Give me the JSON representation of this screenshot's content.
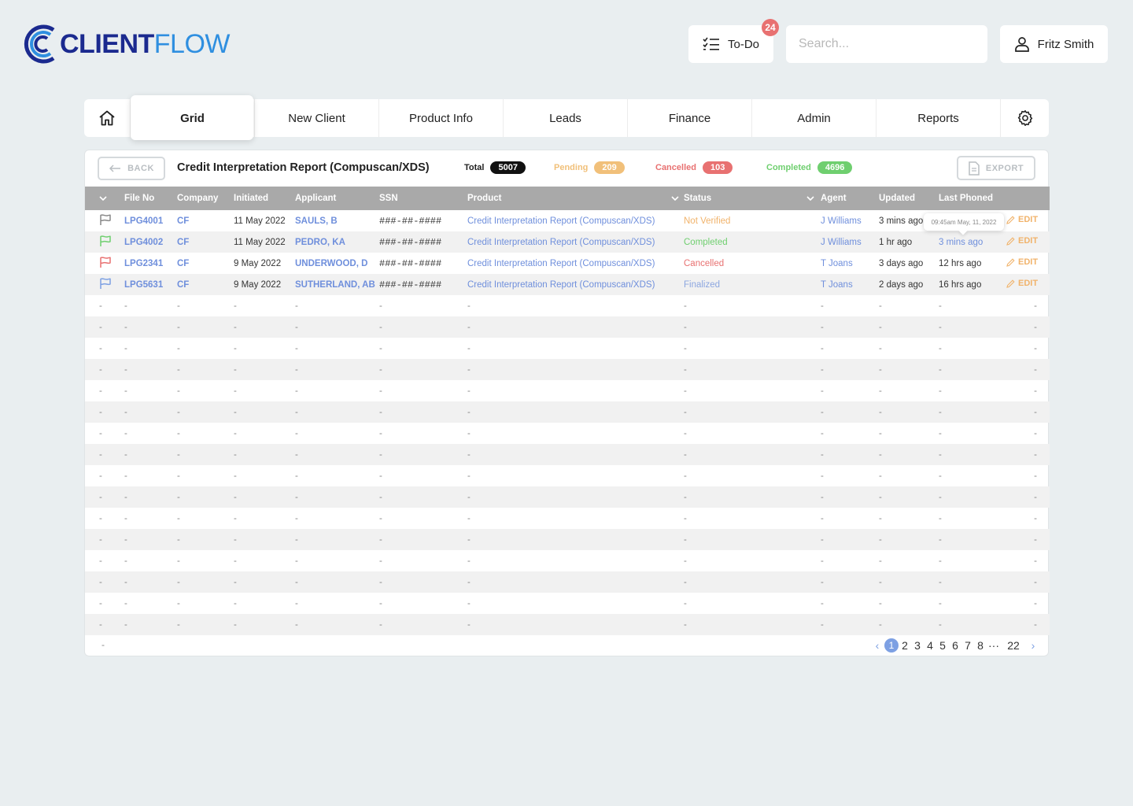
{
  "app": {
    "logo_bold": "CLIENT",
    "logo_light": "FLOW"
  },
  "header": {
    "todo_label": "To-Do",
    "todo_count": "24",
    "search_placeholder": "Search...",
    "user_name": "Fritz Smith"
  },
  "nav": {
    "tabs": [
      {
        "label": "Grid",
        "active": true
      },
      {
        "label": "New Client"
      },
      {
        "label": "Product Info"
      },
      {
        "label": "Leads"
      },
      {
        "label": "Finance"
      },
      {
        "label": "Admin"
      },
      {
        "label": "Reports"
      }
    ]
  },
  "report": {
    "back_label": "BACK",
    "title": "Credit Interpretation Report (Compuscan/XDS)",
    "export_label": "EXPORT",
    "stats": {
      "total": {
        "label": "Total",
        "value": "5007"
      },
      "pending": {
        "label": "Pending",
        "value": "209"
      },
      "cancelled": {
        "label": "Cancelled",
        "value": "103"
      },
      "completed": {
        "label": "Completed",
        "value": "4696"
      }
    }
  },
  "table": {
    "headers": [
      "File No",
      "Company",
      "Initiated",
      "Applicant",
      "SSN",
      "Product",
      "Status",
      "Agent",
      "Updated",
      "Last Phoned"
    ],
    "rows": [
      {
        "flag": "#888888",
        "file": "LPG4001",
        "company": "CF",
        "initiated": "11 May 2022",
        "applicant": "SAULS, B",
        "ssn": "###-##-####",
        "product": "Credit Interpretation Report (Compuscan/XDS)",
        "status": "Not Verified",
        "agent": "J Williams",
        "updated": "3 mins ago",
        "phoned": "",
        "edit": "EDIT"
      },
      {
        "flag": "#6fcf6f",
        "file": "LPG4002",
        "company": "CF",
        "initiated": "11 May 2022",
        "applicant": "PEDRO, KA",
        "ssn": "###-##-####",
        "product": "Credit Interpretation Report (Compuscan/XDS)",
        "status": "Completed",
        "agent": "J Williams",
        "updated": "1 hr ago",
        "phoned": "3 mins ago",
        "edit": "EDIT"
      },
      {
        "flag": "#e87171",
        "file": "LPG2341",
        "company": "CF",
        "initiated": "9 May 2022",
        "applicant": "UNDERWOOD, D",
        "ssn": "###-##-####",
        "product": "Credit Interpretation Report (Compuscan/XDS)",
        "status": "Cancelled",
        "agent": "T Joans",
        "updated": "3 days ago",
        "phoned": "12 hrs ago",
        "edit": "EDIT"
      },
      {
        "flag": "#7da0e3",
        "file": "LPG5631",
        "company": "CF",
        "initiated": "9 May 2022",
        "applicant": "SUTHERLAND, AB",
        "ssn": "###-##-####",
        "product": "Credit Interpretation Report (Compuscan/XDS)",
        "status": "Finalized",
        "agent": "T Joans",
        "updated": "2 days ago",
        "phoned": "16 hrs ago",
        "edit": "EDIT"
      }
    ],
    "empty_placeholder": "-",
    "tooltip": "09:45am May, 11, 2022"
  },
  "pagination": {
    "pages": [
      "1",
      "2",
      "3",
      "4",
      "5",
      "6",
      "7",
      "8"
    ],
    "ellipsis": "···",
    "last": "22",
    "current": "1"
  },
  "colors": {
    "accent": "#6f8fdc",
    "pending": "#f1c07a",
    "cancelled": "#e87171",
    "completed": "#6fcf6f",
    "total": "#111111"
  }
}
